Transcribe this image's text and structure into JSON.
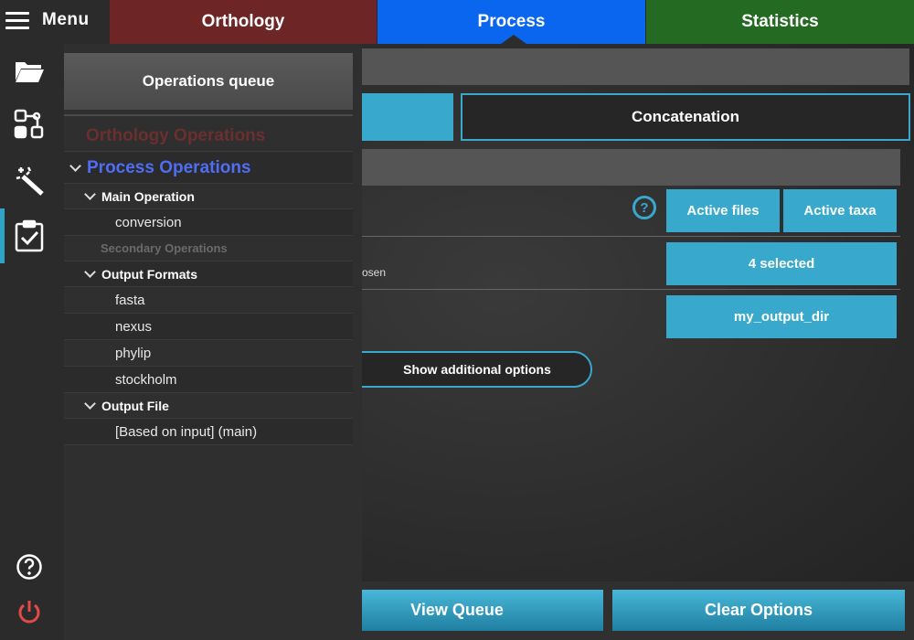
{
  "topbar": {
    "menu_label": "Menu",
    "tabs": [
      {
        "label": "Orthology",
        "color": "#6e2525"
      },
      {
        "label": "Process",
        "color": "#0a66ee",
        "active": true
      },
      {
        "label": "Statistics",
        "color": "#246a22"
      }
    ]
  },
  "sidebar": {
    "icons": [
      "folder-open-icon",
      "process-graph-icon",
      "magic-wand-icon",
      "clipboard-check-icon",
      "help-icon",
      "power-icon"
    ],
    "active_icon": "clipboard-check-icon",
    "accent": "#2fa4c7"
  },
  "queue": {
    "header": "Operations queue",
    "orthology_label": "Orthology Operations",
    "process_label": "Process Operations",
    "main_operation_label": "Main Operation",
    "main_operation_value": "conversion",
    "secondary_label": "Secondary Operations",
    "output_formats_label": "Output Formats",
    "output_formats": [
      "fasta",
      "nexus",
      "phylip",
      "stockholm"
    ],
    "output_file_label": "Output File",
    "output_file_value": "[Based on input] (main)"
  },
  "main": {
    "concatenation_label": "Concatenation",
    "help_glyph": "?",
    "active_files_label": "Active files",
    "active_taxa_label": "Active taxa",
    "chosen_fragment": "osen",
    "selected_label": "4 selected",
    "output_dir_label": "my_output_dir",
    "additional_options_label": "Show additional options",
    "accent": "#38a9cc"
  },
  "footer": {
    "view_queue_label": "View Queue",
    "clear_options_label": "Clear Options"
  }
}
